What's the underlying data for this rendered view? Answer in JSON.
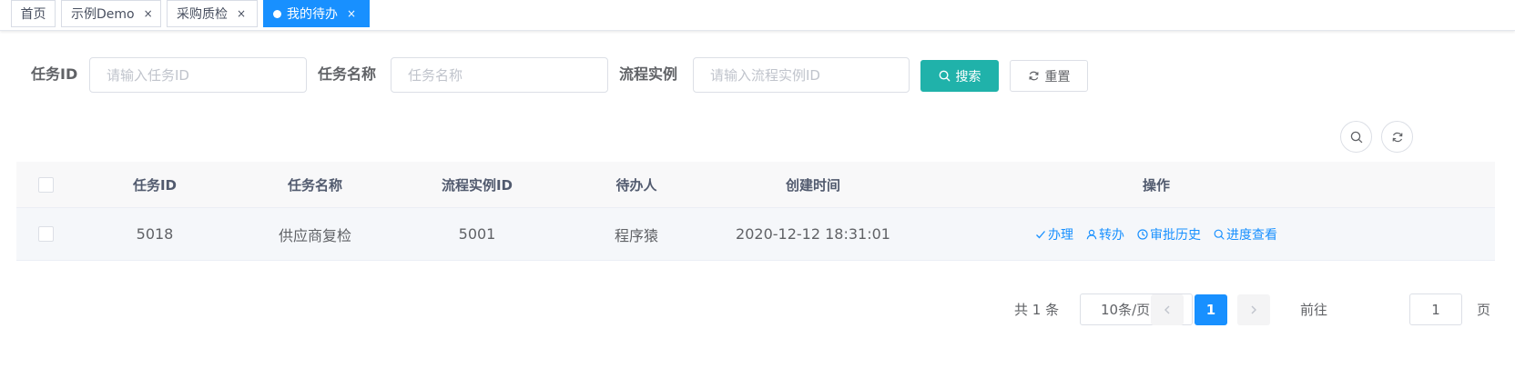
{
  "tabs": [
    {
      "label": "首页",
      "closable": false,
      "active": false
    },
    {
      "label": "示例Demo",
      "closable": true,
      "active": false
    },
    {
      "label": "采购质检",
      "closable": true,
      "active": false
    },
    {
      "label": "我的待办",
      "closable": true,
      "active": true
    }
  ],
  "tab_close_glyph": "×",
  "search": {
    "task_id_label": "任务ID",
    "task_id_placeholder": "请输入任务ID",
    "task_id_value": "",
    "task_name_label": "任务名称",
    "task_name_placeholder": "任务名称",
    "task_name_value": "",
    "process_instance_label": "流程实例",
    "process_instance_placeholder": "请输入流程实例ID",
    "process_instance_value": "",
    "search_button": "搜索",
    "reset_button": "重置"
  },
  "table": {
    "columns": [
      "任务ID",
      "任务名称",
      "流程实例ID",
      "待办人",
      "创建时间",
      "操作"
    ],
    "rows": [
      {
        "task_id": "5018",
        "task_name": "供应商复检",
        "process_instance_id": "5001",
        "assignee": "程序猿",
        "create_time": "2020-12-12 18:31:01",
        "actions": [
          "办理",
          "转办",
          "审批历史",
          "进度查看"
        ]
      }
    ]
  },
  "pagination": {
    "total_text": "共 1 条",
    "page_size": "10条/页",
    "current_page": "1",
    "goto_prefix": "前往",
    "goto_value": "1",
    "goto_suffix": "页"
  },
  "icons": {
    "search_button_icon": "search-icon",
    "reset_button_icon": "refresh-icon",
    "action_icons": [
      "check-icon",
      "user-icon",
      "clock-icon",
      "search-icon"
    ]
  },
  "colors": {
    "accent_blue": "#1890ff",
    "search_button": "#20b2aa",
    "link": "#1890ff"
  }
}
